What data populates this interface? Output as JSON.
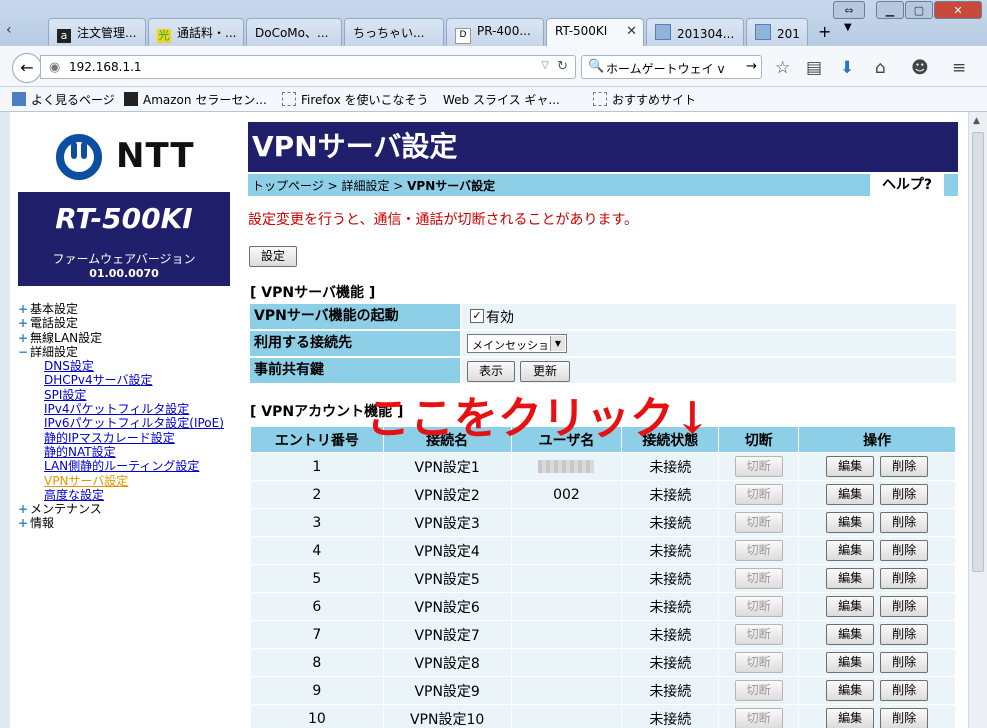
{
  "browser": {
    "tabs": [
      {
        "label": "注文管理...",
        "favicon": "amazon-icon"
      },
      {
        "label": "通話料・...",
        "favicon": "hikari-icon"
      },
      {
        "label": "DoCoMo、...",
        "favicon": "none"
      },
      {
        "label": "ちっちゃい...",
        "favicon": "none"
      },
      {
        "label": "PR-400...",
        "favicon": "page-icon"
      },
      {
        "label": "RT-500KI",
        "favicon": "none",
        "active": true
      },
      {
        "label": "201304...",
        "favicon": "image-icon"
      },
      {
        "label": "201",
        "favicon": "image-icon"
      }
    ],
    "url": "192.168.1.1",
    "search_placeholder": "ホームゲートウェイ v",
    "bookmarks": [
      {
        "label": "よく見るページ",
        "icon": "bookmark-icon"
      },
      {
        "label": "Amazon セラーセン...",
        "icon": "amazon-icon"
      },
      {
        "label": "Firefox を使いこなそう",
        "icon": "page-icon"
      },
      {
        "label": "Web スライス ギャ...",
        "icon": "none"
      },
      {
        "label": "おすすめサイト",
        "icon": "page-icon"
      }
    ]
  },
  "sidebar": {
    "brand": "NTT",
    "model": "RT-500KI",
    "fw_label": "ファームウェアバージョン",
    "fw_version": "01.00.0070",
    "menu": [
      {
        "label": "基本設定",
        "type": "plus"
      },
      {
        "label": "電話設定",
        "type": "plus"
      },
      {
        "label": "無線LAN設定",
        "type": "plus"
      },
      {
        "label": "詳細設定",
        "type": "minus"
      },
      {
        "label": "DNS設定",
        "type": "sub"
      },
      {
        "label": "DHCPv4サーバ設定",
        "type": "sub"
      },
      {
        "label": "SPI設定",
        "type": "sub"
      },
      {
        "label": "IPv4パケットフィルタ設定",
        "type": "sub"
      },
      {
        "label": "IPv6パケットフィルタ設定(IPoE)",
        "type": "sub"
      },
      {
        "label": "静的IPマスカレード設定",
        "type": "sub"
      },
      {
        "label": "静的NAT設定",
        "type": "sub"
      },
      {
        "label": "LAN側静的ルーティング設定",
        "type": "sub"
      },
      {
        "label": "VPNサーバ設定",
        "type": "sub",
        "current": true
      },
      {
        "label": "高度な設定",
        "type": "sub"
      },
      {
        "label": "メンテナンス",
        "type": "plus"
      },
      {
        "label": "情報",
        "type": "plus"
      }
    ]
  },
  "main": {
    "title": "VPNサーバ設定",
    "breadcrumb": "トップページ > 詳細設定 > ",
    "breadcrumb_current": "VPNサーバ設定",
    "help": "ヘルプ?",
    "warning": "設定変更を行うと、通信・通話が切断されることがあります。",
    "settings_button": "設定",
    "vpn_section": "[ VPNサーバ機能 ]",
    "vpn_rows": {
      "enable_label": "VPNサーバ機能の起動",
      "enable_value": "有効",
      "connection_label": "利用する接続先",
      "connection_value": "メインセッション",
      "psk_label": "事前共有鍵",
      "show_button": "表示",
      "update_button": "更新"
    },
    "account_section": "[ VPNアカウント機能 ]",
    "table": {
      "headers": [
        "エントリ番号",
        "接続名",
        "ユーザ名",
        "接続状態",
        "切断",
        "操作"
      ],
      "disconnect_label": "切断",
      "edit_label": "編集",
      "delete_label": "削除",
      "rows": [
        {
          "no": "1",
          "name": "VPN設定1",
          "user": "",
          "status": "未接続",
          "user_blurred": true
        },
        {
          "no": "2",
          "name": "VPN設定2",
          "user": "002",
          "status": "未接続"
        },
        {
          "no": "3",
          "name": "VPN設定3",
          "user": "",
          "status": "未接続"
        },
        {
          "no": "4",
          "name": "VPN設定4",
          "user": "",
          "status": "未接続"
        },
        {
          "no": "5",
          "name": "VPN設定5",
          "user": "",
          "status": "未接続"
        },
        {
          "no": "6",
          "name": "VPN設定6",
          "user": "",
          "status": "未接続"
        },
        {
          "no": "7",
          "name": "VPN設定7",
          "user": "",
          "status": "未接続"
        },
        {
          "no": "8",
          "name": "VPN設定8",
          "user": "",
          "status": "未接続"
        },
        {
          "no": "9",
          "name": "VPN設定9",
          "user": "",
          "status": "未接続"
        },
        {
          "no": "10",
          "name": "VPN設定10",
          "user": "",
          "status": "未接続"
        }
      ]
    },
    "annotation": "ここをクリック↓"
  }
}
